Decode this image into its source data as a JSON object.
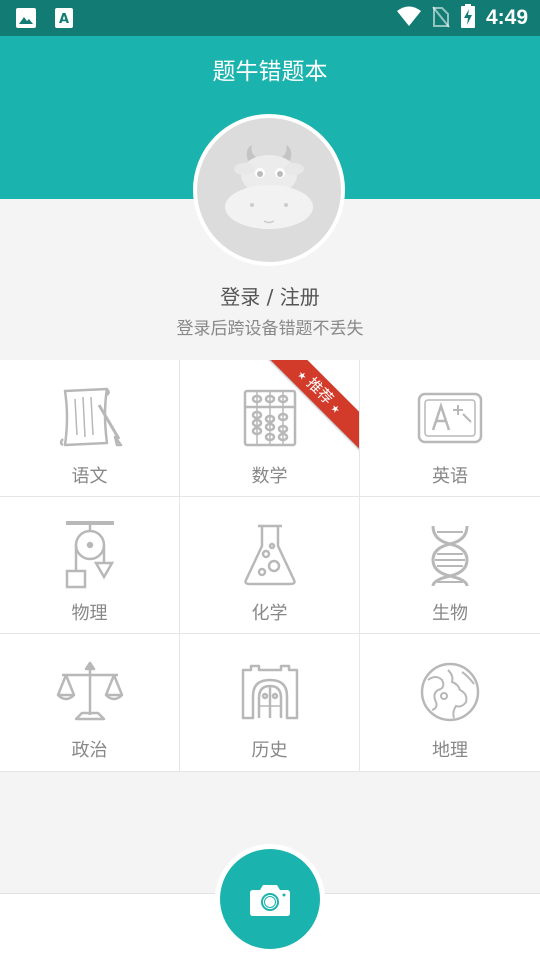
{
  "status_bar": {
    "time": "4:49",
    "left_icons": [
      "image-icon",
      "text-a-icon"
    ],
    "right_icons": [
      "wifi-icon",
      "no-sim-icon",
      "battery-charging-icon"
    ]
  },
  "header": {
    "title": "题牛错题本",
    "bg_color": "#1bb3ae"
  },
  "profile": {
    "avatar_icon": "cow-avatar-icon",
    "login_label": "登录 / 注册",
    "login_subtitle": "登录后跨设备错题不丢失"
  },
  "subjects": [
    {
      "label": "语文",
      "icon": "scroll-icon"
    },
    {
      "label": "数学",
      "icon": "abacus-icon",
      "badge": "推荐"
    },
    {
      "label": "英语",
      "icon": "a-plus-board-icon"
    },
    {
      "label": "物理",
      "icon": "pulley-icon"
    },
    {
      "label": "化学",
      "icon": "flask-icon"
    },
    {
      "label": "生物",
      "icon": "dna-icon"
    },
    {
      "label": "政治",
      "icon": "scales-icon"
    },
    {
      "label": "历史",
      "icon": "castle-gate-icon"
    },
    {
      "label": "地理",
      "icon": "globe-icon"
    }
  ],
  "bottom": {
    "camera_icon": "camera-icon",
    "accent": "#1bb3ae",
    "badge_color": "#d23a2a"
  }
}
